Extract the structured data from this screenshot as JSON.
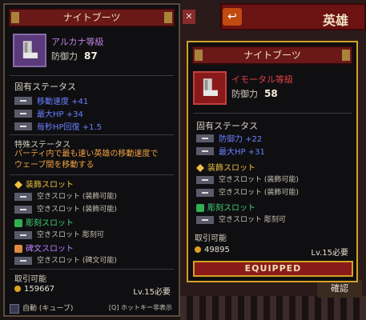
{
  "background": {
    "hero_title": "英雄",
    "close_glyph": "✕",
    "exit_glyph": "↩",
    "confirm_label": "確認"
  },
  "left": {
    "title": "ナイトブーツ",
    "grade": "アルカナ等級",
    "defense_label": "防御力",
    "defense_value": "87",
    "inherent_label": "固有ステータス",
    "stats": [
      "移動速度 +41",
      "最大HP +34",
      "毎秒HP回復 +1.5"
    ],
    "special_label": "特殊ステータス",
    "special_desc_1": "パーティ内で最も速い英雄の移動速度で",
    "special_desc_2": "ウェーブ間を移動する",
    "deco_label": "装飾スロット",
    "deco_slots": [
      "空きスロット (装飾可能)",
      "空きスロット (装飾可能)"
    ],
    "carve_label": "彫刻スロット",
    "carve_slots": [
      "空きスロット 彫刻可"
    ],
    "rune_label": "碑文スロット",
    "rune_slots": [
      "空きスロット (碑文可能)"
    ],
    "tradable": "取引可能",
    "price": "159667",
    "level_req": "Lv.15必要",
    "auto_label": "自動 (キューブ)",
    "hotkey_label": "[Q] ホットキー非表示"
  },
  "right": {
    "title": "ナイトブーツ",
    "grade": "イモータル等級",
    "defense_label": "防御力",
    "defense_value": "58",
    "inherent_label": "固有ステータス",
    "stats": [
      "防御力 +22",
      "最大HP +31"
    ],
    "deco_label": "装飾スロット",
    "deco_slots": [
      "空きスロット (装飾可能)",
      "空きスロット (装飾可能)"
    ],
    "carve_label": "彫刻スロット",
    "carve_slots": [
      "空きスロット 彫刻可"
    ],
    "tradable": "取引可能",
    "price": "49895",
    "level_req": "Lv.15必要",
    "equipped_label": "EQUIPPED"
  },
  "colors": {
    "stat_blue": "#6a80ff",
    "special_orange": "#f0a040",
    "deco_gold": "#f0c040",
    "carve_green": "#40d070",
    "rune_purple": "#c080ff",
    "arcana_purple": "#c080e0",
    "immortal_red": "#e04040"
  }
}
